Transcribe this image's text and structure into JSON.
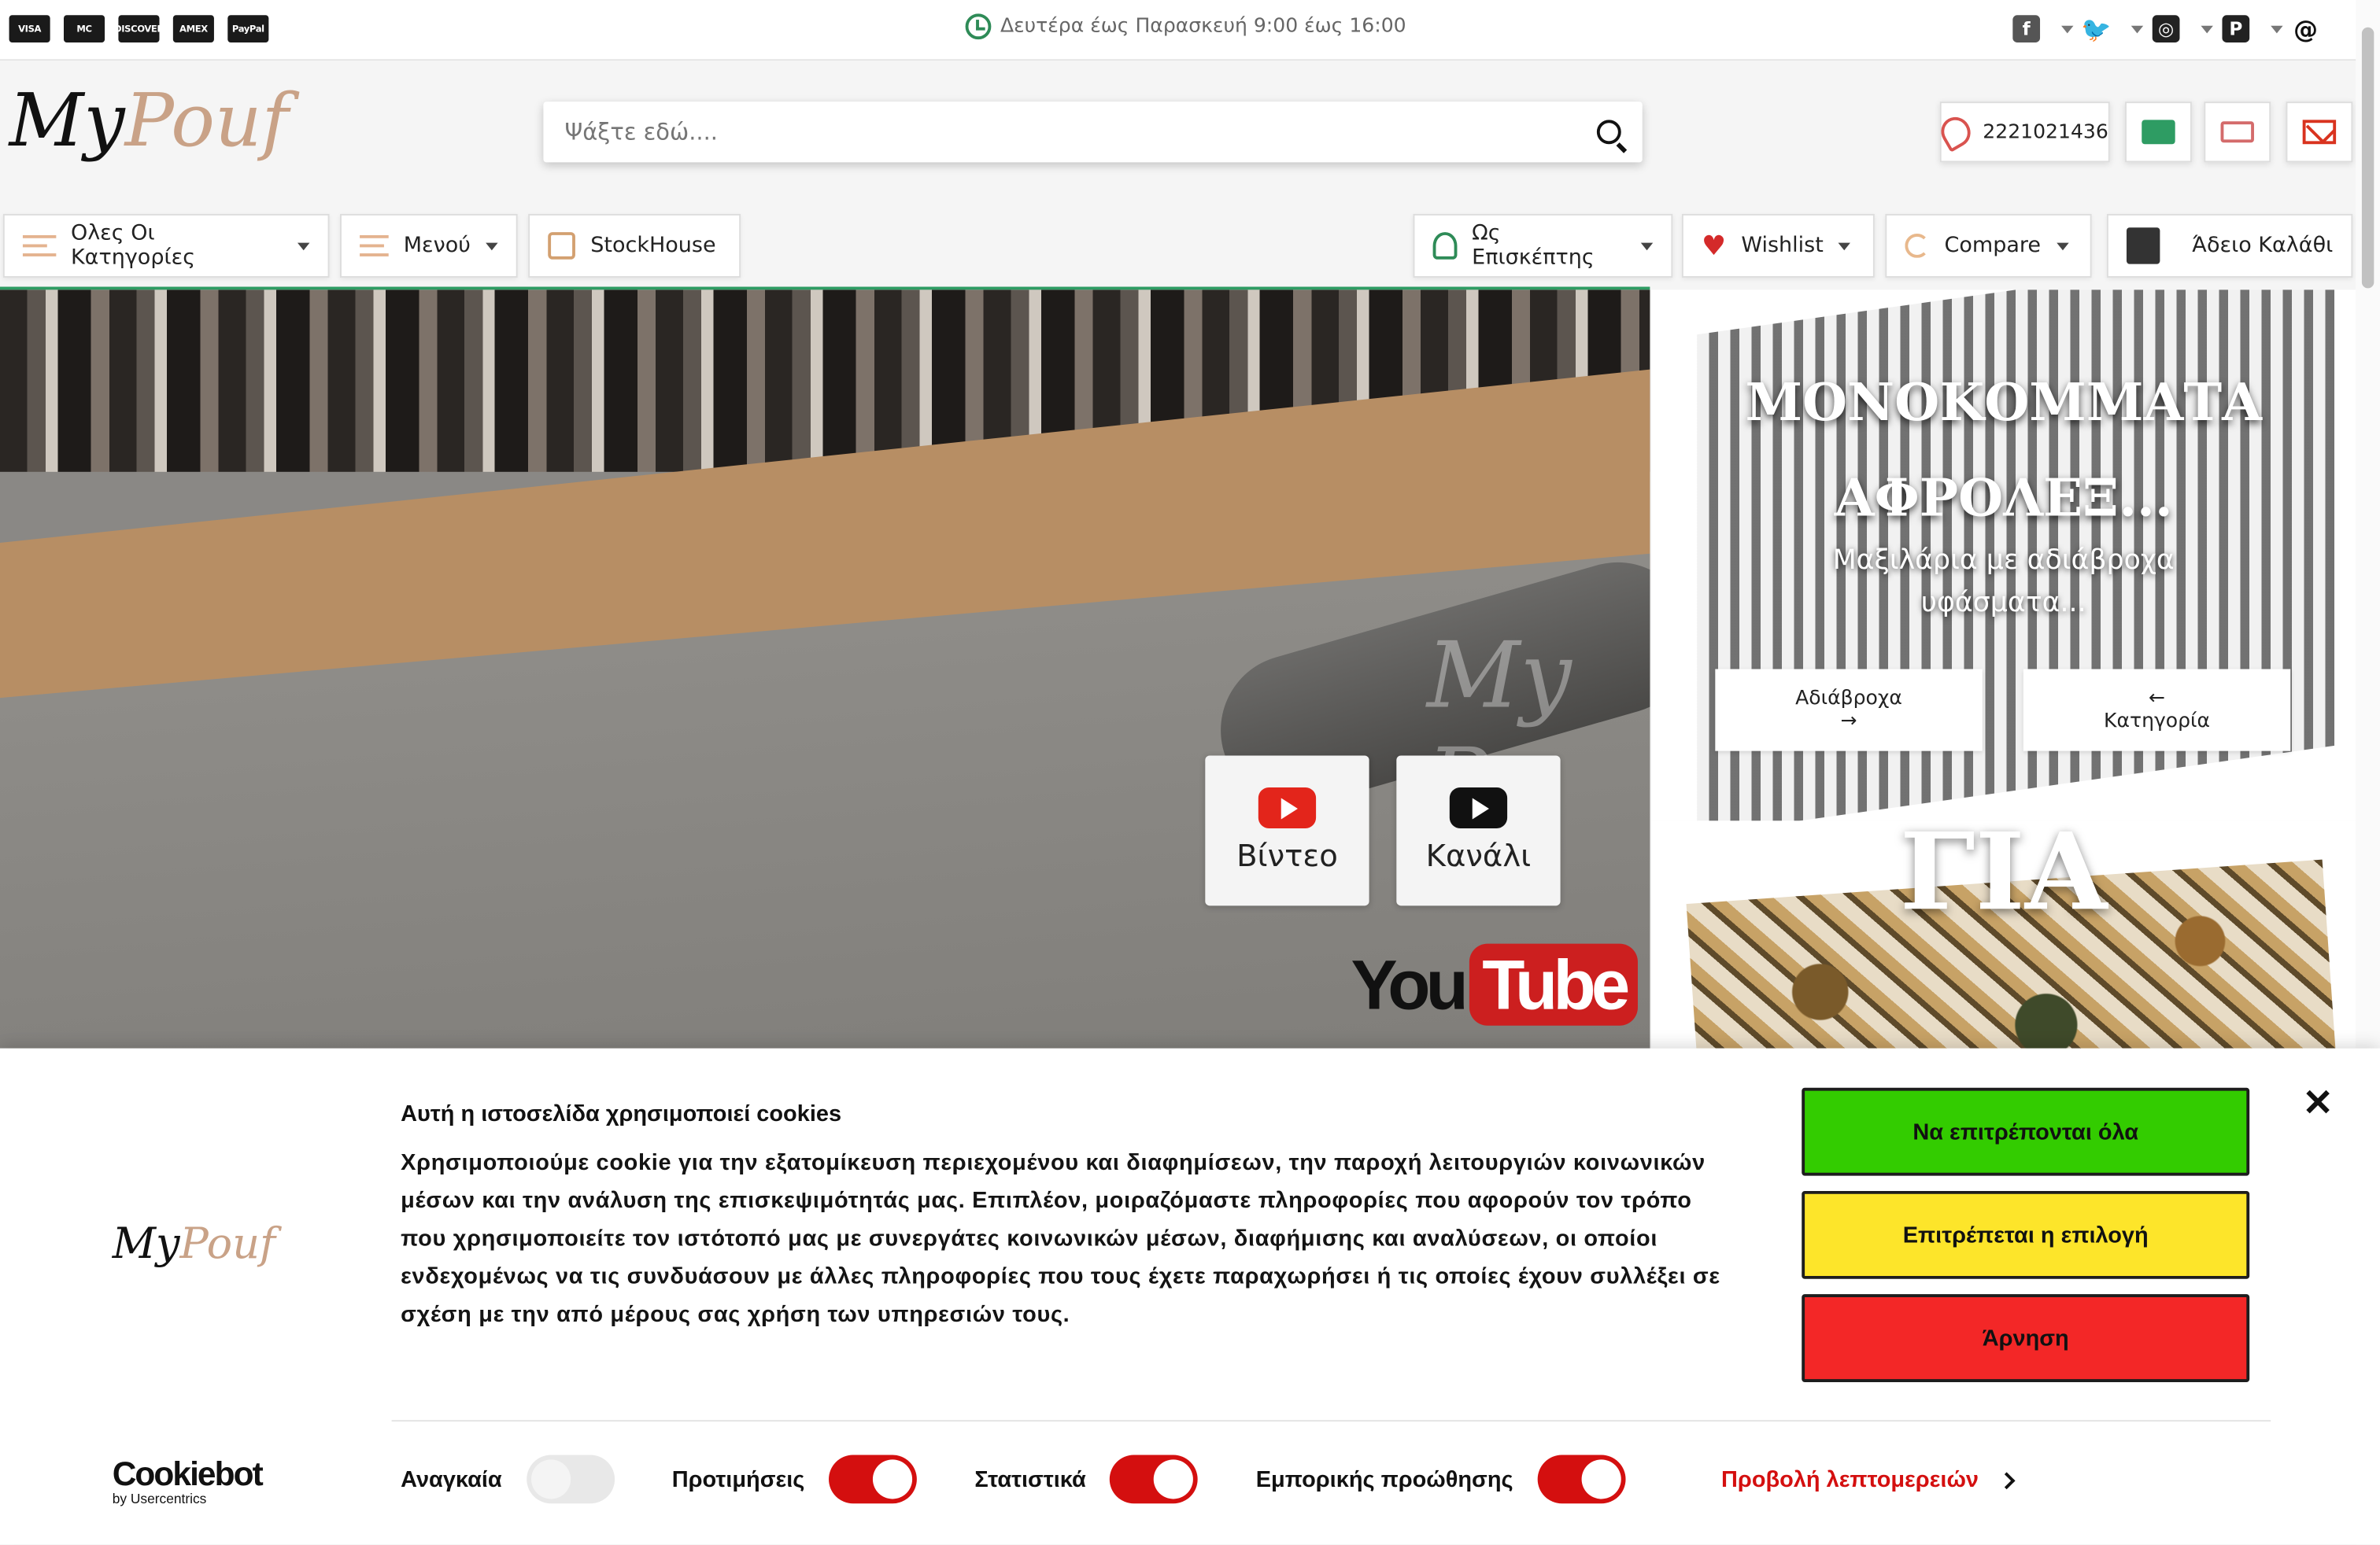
{
  "topbar": {
    "cards": [
      "VISA",
      "MC",
      "DISCOVER",
      "AMEX",
      "PayPal"
    ],
    "hours": "Δευτέρα έως Παρασκευή 9:00 έως 16:00",
    "social": [
      "facebook-icon",
      "twitter-icon",
      "instagram-icon",
      "pinterest-icon",
      "threads-icon"
    ]
  },
  "header": {
    "logo_my": "My",
    "logo_pouf": "Pouf",
    "search_placeholder": "Ψάξτε εδώ....",
    "phone": "2221021436"
  },
  "nav": {
    "categories": "Ολες Οι Κατηγορίες",
    "menu": "Μενού",
    "stockhouse": "StockHouse",
    "guest": "Ως Επισκέπτης",
    "wishlist": "Wishlist",
    "compare": "Compare",
    "cart": "Άδειο Καλάθι"
  },
  "hero": {
    "video_label": "Βίντεο",
    "channel_label": "Κανάλι",
    "yt_you": "You",
    "yt_tube": "Tube",
    "watermark": "My Po"
  },
  "panel1": {
    "title_line1": "ΜΟΝΟΚΟΜΜΑΤΑ",
    "title_line2": "ΑΦΡΟΛΕΞ...",
    "sub_line1": "Μαξιλάρια με αδιάβροχα",
    "sub_line2": "υφάσματα...",
    "btn_left": "Αδιάβροχα",
    "btn_left_arrow": "→",
    "btn_right_arrow": "←",
    "btn_right": "Κατηγορία"
  },
  "panel2": {
    "title": "ΓΙΑ"
  },
  "cookie": {
    "logo_my": "My",
    "logo_pouf": "Pouf",
    "title": "Αυτή η ιστοσελίδα χρησιμοποιεί cookies",
    "text": "Χρησιμοποιούμε cookie για την εξατομίκευση περιεχομένου και διαφημίσεων, την παροχή λειτουργιών κοινωνικών μέσων και την ανάλυση της επισκεψιμότητάς μας. Επιπλέον, μοιραζόμαστε πληροφορίες που αφορούν τον τρόπο που χρησιμοποιείτε τον ιστότοπό μας με συνεργάτες κοινωνικών μέσων, διαφήμισης και αναλύσεων, οι οποίοι ενδεχομένως να τις συνδυάσουν με άλλες πληροφορίες που τους έχετε παραχωρήσει ή τις οποίες έχουν συλλέξει σε σχέση με την από μέρους σας χρήση των υπηρεσιών τους.",
    "allow_all": "Να επιτρέπονται όλα",
    "allow_selection": "Επιτρέπεται η επιλογή",
    "deny": "Άρνηση",
    "cookiebot": "Cookiebot",
    "by": "by Usercentrics",
    "necessary": "Αναγκαία",
    "preferences": "Προτιμήσεις",
    "statistics": "Στατιστικά",
    "marketing": "Εμπορικής προώθησης",
    "details": "Προβολή λεπτομερειών",
    "colors": {
      "allow_all": "#33cc00",
      "allow_selection": "#fde52a",
      "deny": "#f32727",
      "toggle_on": "#d40f0f"
    }
  }
}
